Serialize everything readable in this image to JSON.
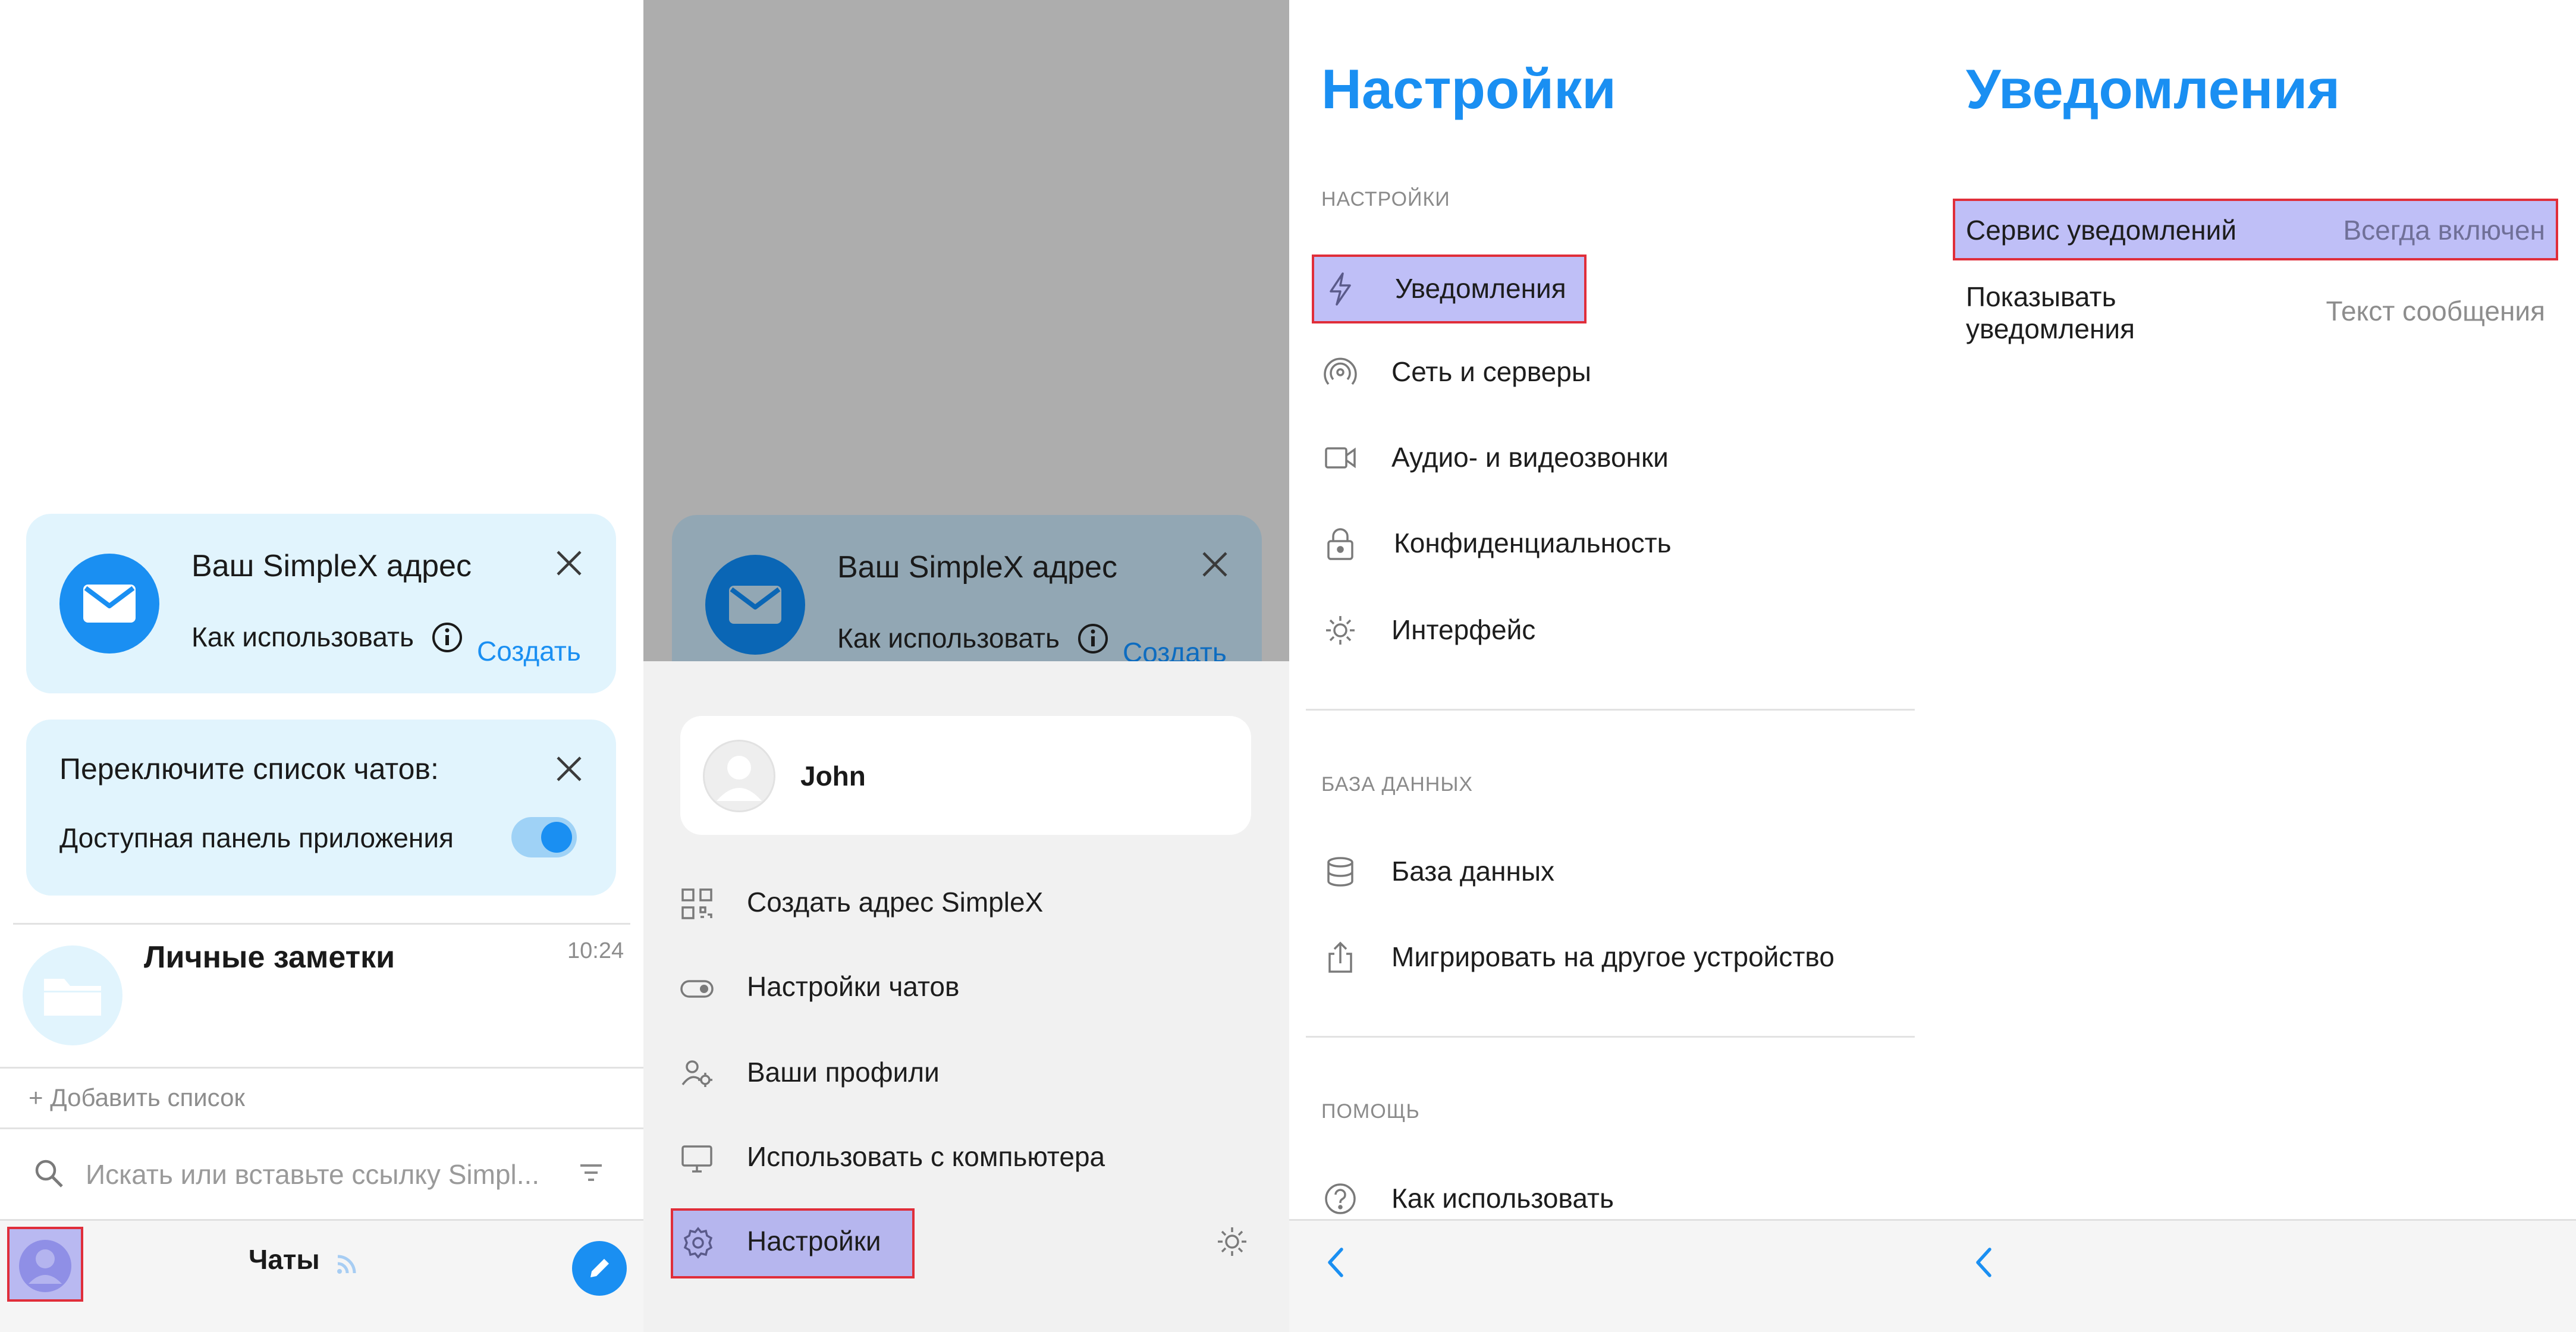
{
  "panel1": {
    "address_card": {
      "title": "Ваш SimpleX адрес",
      "how_to_use": "Как использовать",
      "create": "Создать"
    },
    "switch_card": {
      "title": "Переключите список чатов:",
      "toggle_label": "Доступная панель приложения",
      "toggle_on": true
    },
    "chat_item": {
      "name": "Личные заметки",
      "time": "10:24"
    },
    "add_list": "+ Добавить список",
    "search_placeholder": "Искать или вставьте ссылку Simpl...",
    "bottom_bar": {
      "title": "Чаты"
    }
  },
  "panel2": {
    "address_card": {
      "title": "Ваш SimpleX адрес",
      "how_to_use": "Как использовать",
      "create": "Создать"
    },
    "profile_name": "John",
    "menu": [
      {
        "label": "Создать адрес SimpleX",
        "icon": "qr-code-icon"
      },
      {
        "label": "Настройки чатов",
        "icon": "toggle-icon"
      },
      {
        "label": "Ваши профили",
        "icon": "manage-accounts-icon"
      },
      {
        "label": "Использовать с компьютера",
        "icon": "desktop-icon"
      },
      {
        "label": "Настройки",
        "icon": "gear-icon"
      }
    ]
  },
  "panel3": {
    "title": "Настройки",
    "sections": {
      "settings": "НАСТРОЙКИ",
      "database": "БАЗА ДАННЫХ",
      "help": "ПОМОЩЬ"
    },
    "items": {
      "notifications": "Уведомления",
      "network": "Сеть и серверы",
      "calls": "Аудио- и видеозвонки",
      "privacy": "Конфиденциальность",
      "appearance": "Интерфейс",
      "database": "База данных",
      "migrate": "Мигрировать на другое устройство",
      "how_to_use": "Как использовать"
    }
  },
  "panel4": {
    "title": "Уведомления",
    "rows": [
      {
        "label": "Сервис уведомлений",
        "value": "Всегда включен"
      },
      {
        "label": "Показывать\nуведомления",
        "value": "Текст сообщения"
      }
    ]
  },
  "colors": {
    "accent": "#1a8ff2",
    "card_bg": "#e1f4fd",
    "highlight": "#6060eb",
    "highlight_border": "#e02e3a"
  }
}
